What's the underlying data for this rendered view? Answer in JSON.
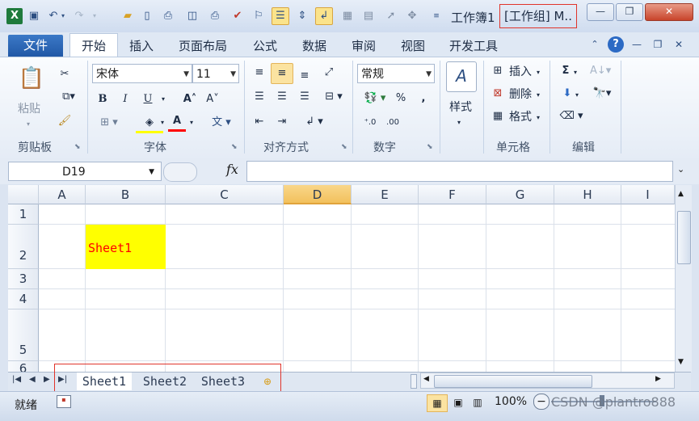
{
  "title_bar": {
    "title": "工作簿1",
    "group_title": "[工作组] M..",
    "quick_access_icons": [
      "excel-logo-icon",
      "save-icon",
      "undo-icon",
      "undo-dropdown-icon",
      "redo-icon",
      "open-folder-icon",
      "new-file-icon",
      "print-preview-icon",
      "print-preview-2-icon",
      "print-icon",
      "spell-check-icon",
      "format-painter-qa-icon",
      "align-center-qa-icon",
      "align-middle-qa-icon",
      "wrap-qa-icon",
      "camera-icon",
      "pointer-icon",
      "select-objects-icon",
      "customize-qa-icon"
    ],
    "minimize_glyph": "—",
    "restore_glyph": "❐",
    "close_glyph": "✕"
  },
  "tabs": {
    "file": "文件",
    "items": [
      "开始",
      "插入",
      "页面布局",
      "公式",
      "数据",
      "审阅",
      "视图",
      "开发工具"
    ],
    "active": "开始"
  },
  "ribbon": {
    "clipboard": {
      "paste": "粘贴",
      "label": "剪贴板"
    },
    "font": {
      "name": "宋体",
      "size": "11",
      "label": "字体",
      "bold": "B",
      "italic": "I",
      "underline": "U"
    },
    "alignment": {
      "label": "对齐方式"
    },
    "number": {
      "format": "常规",
      "label": "数字",
      "percent": "%",
      "comma": ","
    },
    "styles": {
      "label": "样式"
    },
    "cells": {
      "insert": "插入",
      "delete": "删除",
      "format": "格式",
      "label": "单元格"
    },
    "editing": {
      "label": "编辑",
      "sum": "Σ"
    }
  },
  "formula_bar": {
    "name_box": "D19",
    "fx": "fx",
    "content": ""
  },
  "grid": {
    "columns": [
      "A",
      "B",
      "C",
      "D",
      "E",
      "F",
      "G",
      "H",
      "I"
    ],
    "active_column": "D",
    "rows": [
      "1",
      "2",
      "3",
      "4",
      "5",
      "6"
    ],
    "cells": {
      "B2": "Sheet1"
    },
    "colors": {
      "b2_fill": "#ffff00",
      "b2_text": "#ff0000"
    }
  },
  "sheet_tabs": {
    "nav": [
      "◀◀",
      "◀",
      "▶",
      "▶▶"
    ],
    "items": [
      "Sheet1",
      "Sheet2",
      "Sheet3"
    ],
    "active": "Sheet1"
  },
  "status_bar": {
    "mode": "就绪",
    "zoom": "100%",
    "zoom_minus": "−",
    "watermark": "CSDN @plantro888"
  },
  "colors": {
    "annotation_red": "#e0342b",
    "file_tab": "#2a66b6"
  }
}
